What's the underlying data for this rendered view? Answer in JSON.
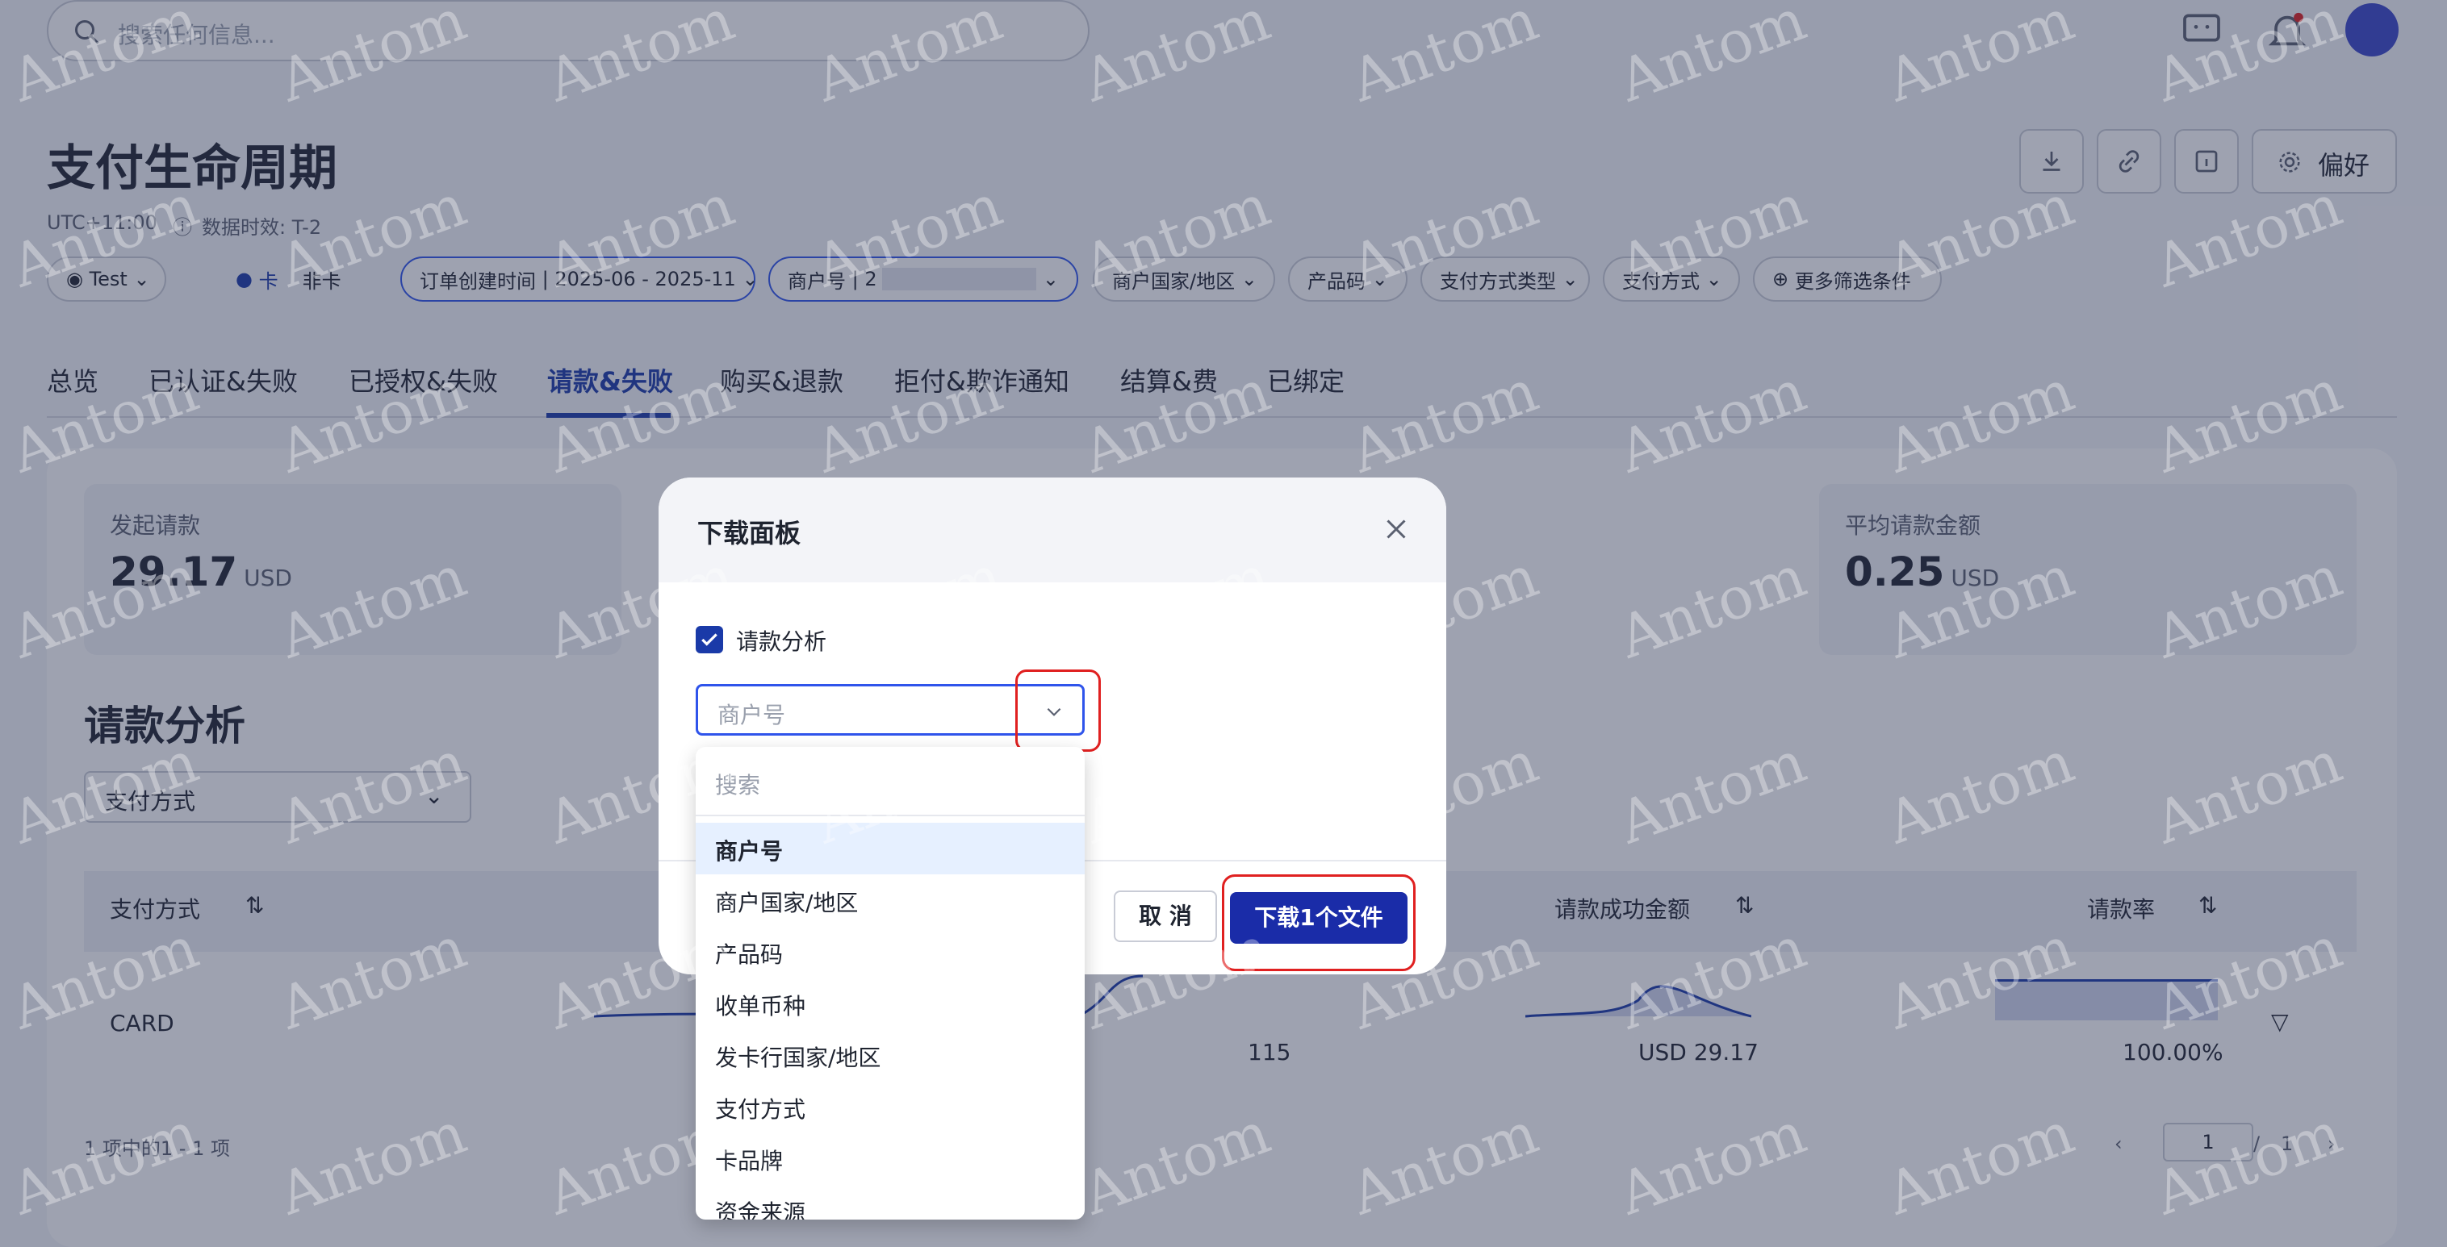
{
  "header": {
    "search_placeholder": "搜索任何信息...",
    "icons": [
      "search-icon",
      "chat-icon",
      "bell-icon",
      "avatar"
    ]
  },
  "page": {
    "title": "支付生命周期",
    "timezone": "UTC+11:00",
    "data_latency": "数据时效: T-2",
    "preferences_label": "偏好"
  },
  "filters": {
    "env": "Test",
    "card": "卡",
    "noncard": "非卡",
    "order_time_label": "订单创建时间",
    "order_time_value": "2025-06 - 2025-11",
    "merchant_label": "商户号",
    "merchant_value": "2",
    "merchant_region": "商户国家/地区",
    "product_code": "产品码",
    "payment_method_type": "支付方式类型",
    "payment_method": "支付方式",
    "more_filters": "更多筛选条件"
  },
  "tabs": [
    "总览",
    "已认证&失败",
    "已授权&失败",
    "请款&失败",
    "购买&退款",
    "拒付&欺诈通知",
    "结算&费",
    "已绑定"
  ],
  "cards": [
    {
      "label": "发起请款",
      "value": "29.17",
      "unit": "USD"
    },
    {
      "label": "平均请款金额",
      "value": "0.25",
      "unit": "USD"
    }
  ],
  "section": {
    "title": "请款分析",
    "group_select": "支付方式"
  },
  "table": {
    "headers": [
      "支付方式",
      "请款成功金额",
      "请款率"
    ],
    "row": {
      "method": "CARD",
      "count": "115",
      "amount": "USD 29.17",
      "rate": "100.00%"
    },
    "footer": "1 项中的1 - 1 项",
    "page_current": "1",
    "page_sep": "/",
    "page_total": "1"
  },
  "modal": {
    "title": "下载面板",
    "checkbox_label": "请款分析",
    "combo_placeholder": "商户号",
    "cancel": "取 消",
    "download": "下载1个文件"
  },
  "dropdown": {
    "search_placeholder": "搜索",
    "options": [
      "商户号",
      "商户国家/地区",
      "产品码",
      "收单币种",
      "发卡行国家/地区",
      "支付方式",
      "卡品牌",
      "资金来源"
    ],
    "selected_index": 0
  },
  "watermark": "Antom"
}
